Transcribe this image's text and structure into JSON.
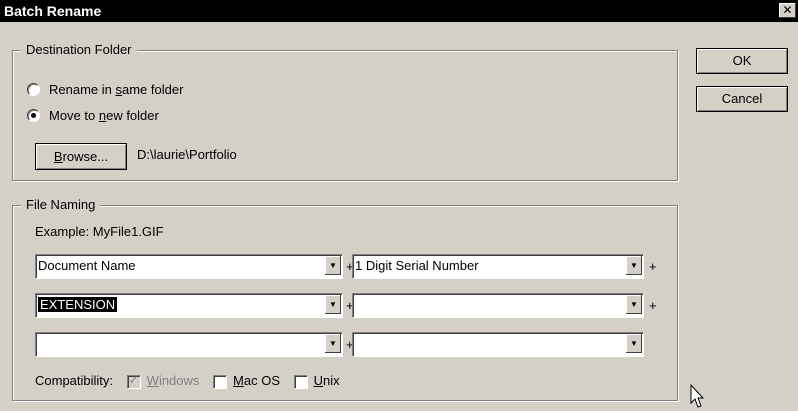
{
  "window": {
    "title": "Batch Rename",
    "close_glyph": "✕"
  },
  "destination": {
    "legend": "Destination Folder",
    "options": [
      {
        "pre": "Rename in ",
        "accel": "s",
        "post": "ame folder",
        "checked": false
      },
      {
        "pre": "Move to ",
        "accel": "n",
        "post": "ew folder",
        "checked": true
      }
    ],
    "browse": {
      "accel": "B",
      "rest": "rowse..."
    },
    "path": "D:\\laurie\\Portfolio"
  },
  "naming": {
    "legend": "File Naming",
    "example": "Example: MyFile1.GIF",
    "fields": [
      [
        "Document Name",
        "1 Digit Serial Number"
      ],
      [
        "EXTENSION",
        ""
      ],
      [
        "",
        ""
      ]
    ],
    "plus": "+"
  },
  "compat": {
    "label": "Compatibility:",
    "windows": {
      "accel": "W",
      "rest": "indows",
      "checked": true,
      "disabled": true
    },
    "mac": {
      "accel": "M",
      "rest": "ac OS",
      "checked": false
    },
    "unix": {
      "accel": "U",
      "rest": "nix",
      "checked": false
    }
  },
  "buttons": {
    "ok": "OK",
    "cancel": "Cancel"
  },
  "icons": {
    "dropdown": "▼",
    "check": "✓"
  }
}
